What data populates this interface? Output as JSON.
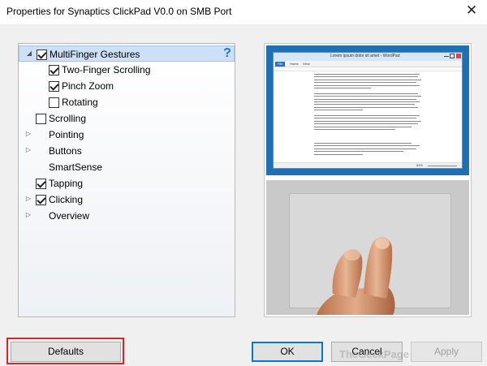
{
  "window": {
    "title": "Properties for Synaptics ClickPad V0.0 on SMB Port",
    "close_glyph": "✕"
  },
  "tree": {
    "help_glyph": "?",
    "items": [
      {
        "label": "MultiFinger Gestures",
        "expander": "◢",
        "checkbox": true,
        "checked": true,
        "selected": true,
        "level": 0
      },
      {
        "label": "Two-Finger Scrolling",
        "expander": "",
        "checkbox": true,
        "checked": true,
        "selected": false,
        "level": 1
      },
      {
        "label": "Pinch Zoom",
        "expander": "",
        "checkbox": true,
        "checked": true,
        "selected": false,
        "level": 1
      },
      {
        "label": "Rotating",
        "expander": "",
        "checkbox": true,
        "checked": false,
        "selected": false,
        "level": 1
      },
      {
        "label": "Scrolling",
        "expander": "",
        "checkbox": true,
        "checked": false,
        "selected": false,
        "level": 0
      },
      {
        "label": "Pointing",
        "expander": "▷",
        "checkbox": false,
        "checked": false,
        "selected": false,
        "level": 0
      },
      {
        "label": "Buttons",
        "expander": "▷",
        "checkbox": false,
        "checked": false,
        "selected": false,
        "level": 0
      },
      {
        "label": "SmartSense",
        "expander": "",
        "checkbox": false,
        "checked": false,
        "selected": false,
        "level": 0
      },
      {
        "label": "Tapping",
        "expander": "",
        "checkbox": true,
        "checked": true,
        "selected": false,
        "level": 0
      },
      {
        "label": "Clicking",
        "expander": "▷",
        "checkbox": true,
        "checked": true,
        "selected": false,
        "level": 0
      },
      {
        "label": "Overview",
        "expander": "▷",
        "checkbox": false,
        "checked": false,
        "selected": false,
        "level": 0
      }
    ]
  },
  "preview": {
    "wordpad_title": "Lorem ipsum dolor sit amet - WordPad",
    "ribbon_file": "File",
    "ribbon_home": "Home",
    "ribbon_view": "View",
    "zoom": "64%"
  },
  "buttons": {
    "defaults": "Defaults",
    "ok": "OK",
    "cancel": "Cancel",
    "apply": "Apply"
  },
  "watermark": "TheGeekPage",
  "colors": {
    "highlight": "#d9242b",
    "selection": "#cde0f7",
    "accent": "#0078d7",
    "desktop": "#1f6fb4"
  }
}
